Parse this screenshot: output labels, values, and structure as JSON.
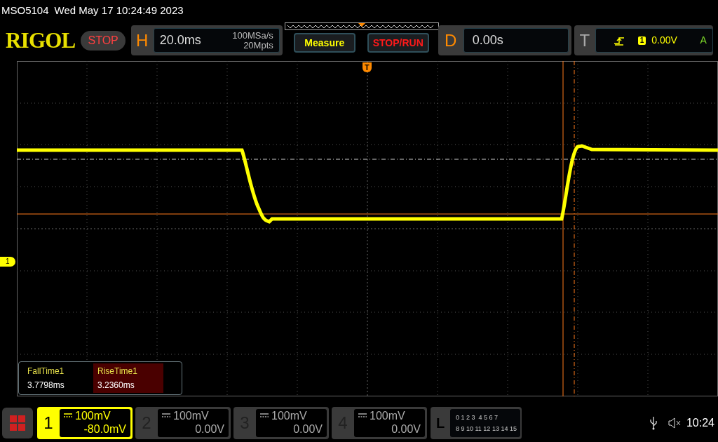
{
  "header": {
    "model": "MSO5104",
    "datetime": "Wed May 17 10:24:49 2023"
  },
  "logo": "RIGOL",
  "run_status": "STOP",
  "horizontal": {
    "label": "H",
    "timebase": "20.0ms",
    "sample_rate": "100MSa/s",
    "memory_depth": "20Mpts"
  },
  "buttons": [
    {
      "label": "Measure",
      "kind": "measure"
    },
    {
      "label": "STOP/RUN",
      "kind": "run"
    }
  ],
  "delay": {
    "label": "D",
    "value": "0.00s"
  },
  "trigger": {
    "label": "T",
    "source": "1",
    "level": "0.00V",
    "mode": "A"
  },
  "trigger_marker": "T",
  "channel_marker": "1",
  "measurements": [
    {
      "name": "FallTime1",
      "value": "3.7798ms",
      "selected": false
    },
    {
      "name": "RiseTime1",
      "value": "3.2360ms",
      "selected": true
    }
  ],
  "channels": [
    {
      "number": "1",
      "scale": "100mV",
      "offset": "-80.0mV",
      "selected": true
    },
    {
      "number": "2",
      "scale": "100mV",
      "offset": "0.00V",
      "selected": false
    },
    {
      "number": "3",
      "scale": "100mV",
      "offset": "0.00V",
      "selected": false
    },
    {
      "number": "4",
      "scale": "100mV",
      "offset": "0.00V",
      "selected": false
    }
  ],
  "logic": {
    "label": "L",
    "bits_row_1": "0 1 2 3  4 5 6 7",
    "bits_row_2": "8 9 10 11 12 13 14 15"
  },
  "status_bar": {
    "time": "10:24"
  }
}
